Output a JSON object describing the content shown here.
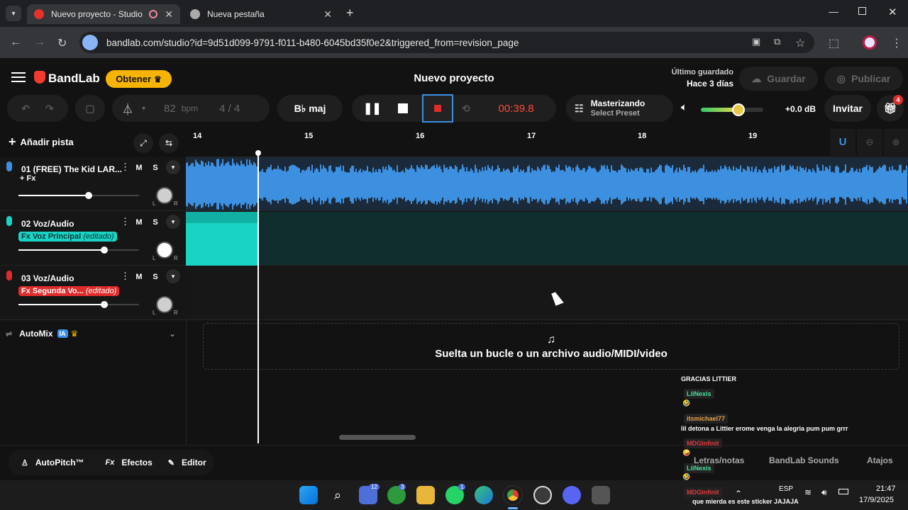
{
  "browser": {
    "tabs": [
      {
        "title": "Nuevo proyecto - Studio",
        "active": true
      },
      {
        "title": "Nueva pestaña",
        "active": false
      }
    ],
    "url": "bandlab.com/studio?id=9d51d099-9791-f011-b480-6045bd35f0e2&triggered_from=revision_page"
  },
  "app": {
    "logo": "BandLab",
    "get_button": "Obtener",
    "project_title": "Nuevo proyecto",
    "saved_label": "Último guardado",
    "saved_time": "Hace 3 días",
    "save_button": "Guardar",
    "publish_button": "Publicar",
    "bpm_value": "82",
    "bpm_unit": "bpm",
    "time_sig": "4 / 4",
    "key": "B♭ maj",
    "time_display": "00:39.8",
    "mastering_title": "Masterizando",
    "mastering_preset": "Select Preset",
    "volume_fraction": 0.6,
    "volume_db": "+0.0 dB",
    "invite_button": "Invitar",
    "gift_badge": "4",
    "add_track": "Añadir pista",
    "ruler": [
      "14",
      "15",
      "16",
      "17",
      "18",
      "19"
    ],
    "tracks": [
      {
        "name": "01  (FREE) The Kid LAR...",
        "fx": "+ Fx",
        "fx_edited": "",
        "volume_fraction": 0.58,
        "color": "#3d8fe0",
        "mute": "M",
        "solo": "S",
        "pan_l": "L",
        "pan_r": "R"
      },
      {
        "name": "02  Voz/Audio",
        "fx": "Fx Voz Principal",
        "fx_edited": "(editado)",
        "volume_fraction": 0.71,
        "color": "#19d3c5",
        "mute": "M",
        "solo": "S",
        "pan_l": "L",
        "pan_r": "R"
      },
      {
        "name": "03  Voz/Audio",
        "fx": "Fx Segunda Vo...",
        "fx_edited": "(editado)",
        "volume_fraction": 0.71,
        "color": "#e02b2b",
        "mute": "M",
        "solo": "S",
        "pan_l": "L",
        "pan_r": "R"
      }
    ],
    "automix": "AutoMix",
    "automix_badge": "IA",
    "drop_text": "Suelta un bucle o un archivo audio/MIDI/video",
    "bottom": {
      "autopitch": "AutoPitch™",
      "effects": "Efectos",
      "editor": "Editor",
      "lyrics": "Letras/notas",
      "sounds": "BandLab Sounds",
      "shortcuts": "Atajos"
    }
  },
  "chat": {
    "top_message": "GRACIAS LITTIER",
    "entries": [
      {
        "user": "LilNexis",
        "user_color": "#4ce0a0",
        "message": "🤣"
      },
      {
        "user": "itsmichael77",
        "user_color": "#e8a04a",
        "message": "lil detona a Littier erome venga la alegria pum pum grrr"
      },
      {
        "user": "MDGInfinit",
        "user_color": "#e03a3a",
        "message": "🤪"
      },
      {
        "user": "LilNexis",
        "user_color": "#4ce0a0",
        "message": "🤣"
      },
      {
        "user": "MDGInfinit",
        "user_color": "#e03a3a",
        "message": "que mierda es este sticker JAJAJA"
      }
    ]
  },
  "taskbar": {
    "lang": "ESP",
    "time": "21:47",
    "date": "17/9/2025",
    "badge_teams": "12",
    "badge_xbox": "3",
    "badge_whatsapp": "1"
  }
}
